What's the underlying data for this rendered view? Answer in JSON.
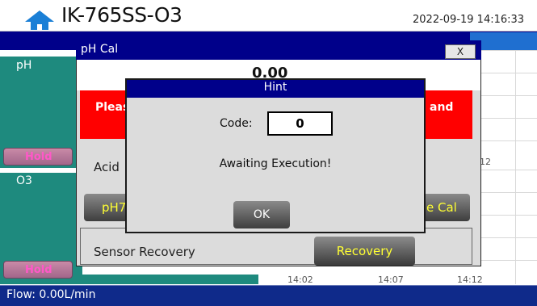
{
  "header": {
    "device_name": "IK-765SS-O3",
    "datetime": "2022-09-19 14:16:33",
    "home_icon": "home-icon"
  },
  "panels": {
    "ph_label": "pH",
    "o3_label": "O3",
    "hold_label": "Hold",
    "chart_ticks": [
      "14:02",
      "14:07",
      "14:12"
    ],
    "right_tick_mid": "12"
  },
  "footer": {
    "flow": "Flow:  0.00L/min"
  },
  "ph_cal_dialog": {
    "title": "pH Cal",
    "close_label": "X",
    "value": "0.00",
    "instruction_left": "Pleas",
    "instruction_right": "and",
    "acid_label": "Acid",
    "ph7_label": "pH7",
    "cal_label": "e Cal",
    "sensor_recovery_label": "Sensor Recovery",
    "recovery_button": "Recovery"
  },
  "hint_dialog": {
    "title": "Hint",
    "code_label": "Code:",
    "code_value": "0",
    "message": "Awaiting Execution!",
    "ok_label": "OK"
  },
  "colors": {
    "navy": "#00008a",
    "teal": "#1e8a7e",
    "alert_red": "#ff0000",
    "button_text_yellow": "#ffff33",
    "hold_pink": "#ff58c8"
  }
}
